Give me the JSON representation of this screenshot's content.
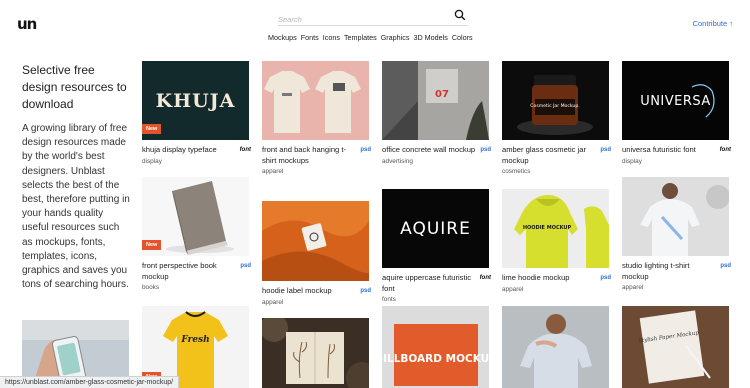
{
  "header": {
    "logo": "un",
    "search_placeholder": "Search",
    "nav": [
      "Mockups",
      "Fonts",
      "Icons",
      "Templates",
      "Graphics",
      "3D Models",
      "Colors"
    ],
    "contribute": "Contribute ↑"
  },
  "intro": {
    "title": "Selective free design resources to download",
    "body": "A growing library of free design resources made by the world's best designers. Unblast selects the best of the best, therefore putting in your hands quality useful resources such as mockups, fonts, templates, icons, graphics and saves you tons of searching hours."
  },
  "cards": [
    {
      "title": "khuja display typeface",
      "category": "display",
      "tag": "font",
      "new": "New",
      "thumb_text": "KHUJA"
    },
    {
      "title": "front and back hanging t-shirt mockups",
      "category": "apparel",
      "tag": "psd",
      "new": "",
      "thumb_text": ""
    },
    {
      "title": "office concrete wall mockup",
      "category": "advertising",
      "tag": "psd",
      "new": "",
      "thumb_text": "07"
    },
    {
      "title": "amber glass cosmetic jar mockup",
      "category": "cosmetics",
      "tag": "psd",
      "new": "",
      "thumb_text": "Cosmetic Jar Mockup."
    },
    {
      "title": "universa futuristic font",
      "category": "display",
      "tag": "font",
      "new": "",
      "thumb_text": "UNIVERSA"
    },
    {
      "title": "front perspective book mockup",
      "category": "books",
      "tag": "psd",
      "new": "New",
      "thumb_text": ""
    },
    {
      "title": "hoodie label mockup",
      "category": "apparel",
      "tag": "psd",
      "new": "",
      "thumb_text": ""
    },
    {
      "title": "aquire uppercase futuristic font",
      "category": "fonts",
      "tag": "font",
      "new": "",
      "thumb_text": "AQUIRE"
    },
    {
      "title": "lime hoodie mockup",
      "category": "apparel",
      "tag": "psd",
      "new": "",
      "thumb_text": "HOODIE MOCKUP"
    },
    {
      "title": "studio lighting t-shirt mockup",
      "category": "apparel",
      "tag": "psd",
      "new": "",
      "thumb_text": ""
    },
    {
      "title": "",
      "category": "",
      "tag": "",
      "new": "New",
      "thumb_text": "Fresh"
    },
    {
      "title": "",
      "category": "",
      "tag": "",
      "new": "",
      "thumb_text": ""
    },
    {
      "title": "",
      "category": "",
      "tag": "",
      "new": "",
      "thumb_text": "BILLBOARD MOCKUP"
    },
    {
      "title": "",
      "category": "",
      "tag": "",
      "new": "",
      "thumb_text": ""
    },
    {
      "title": "",
      "category": "",
      "tag": "",
      "new": "",
      "thumb_text": "Stylish Paper Mockup"
    },
    {
      "title": "",
      "category": "",
      "tag": "",
      "new": "",
      "thumb_text": ""
    }
  ],
  "status_url": "https://unblast.com/amber-glass-cosmetic-jar-mockup/",
  "colors": {
    "accent": "#2d6cd3",
    "new_badge": "#e5532b"
  }
}
